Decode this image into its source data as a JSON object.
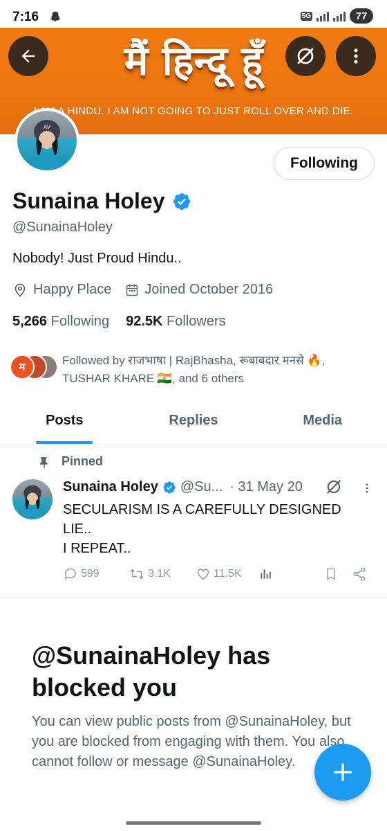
{
  "status_bar": {
    "time": "7:16",
    "network_badge": "5G",
    "battery": "77"
  },
  "banner": {
    "title": "मैं हिन्दू हूँ",
    "subtitle": "I AM A HINDU. I AM NOT GOING TO JUST ROLL OVER AND DIE.",
    "color": "#ef7613"
  },
  "profile": {
    "follow_button": "Following",
    "display_name": "Sunaina Holey",
    "handle": "@SunainaHoley",
    "bio": "Nobody! Just Proud Hindu..",
    "location": "Happy Place",
    "joined": "Joined October 2016",
    "following_count": "5,266",
    "following_label": "Following",
    "followers_count": "92.5K",
    "followers_label": "Followers",
    "followed_by_line1": "Followed by राजभाषा | RajBhasha, रूबाबदार मनसे 🔥,",
    "followed_by_line2": "TUSHAR KHARE 🇮🇳, and 6 others",
    "mini_avatar_letter": "म"
  },
  "tabs": [
    {
      "label": "Posts",
      "active": true
    },
    {
      "label": "Replies",
      "active": false
    },
    {
      "label": "Media",
      "active": false
    }
  ],
  "pinned_tweet": {
    "pinned_label": "Pinned",
    "name": "Sunaina Holey",
    "handle": "@Su...",
    "date": "· 31 May 20",
    "text_line1": "SECULARISM IS A CAREFULLY DESIGNED",
    "text_line2": "LIE..",
    "text_line3": "I REPEAT..",
    "replies": "599",
    "reposts": "3.1K",
    "likes": "11.5K"
  },
  "blocked": {
    "title": "@SunainaHoley has blocked you",
    "body": "You can view public posts from @SunainaHoley, but you are blocked from engaging with them. You also cannot follow or message @SunainaHoley."
  },
  "colors": {
    "accent": "#1d9bf0",
    "text_primary": "#0f1419",
    "text_secondary": "#536471"
  },
  "icons": [
    "back-arrow-icon",
    "grok-icon",
    "more-vertical-icon",
    "verified-badge-icon",
    "location-icon",
    "calendar-icon",
    "pin-icon",
    "reply-icon",
    "repost-icon",
    "like-icon",
    "views-icon",
    "bookmark-icon",
    "share-icon",
    "plus-icon"
  ]
}
